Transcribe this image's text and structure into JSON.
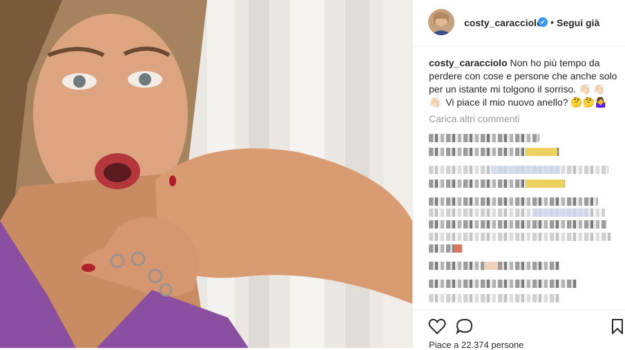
{
  "post": {
    "username": "costy_caracciolo",
    "follow_status": "Segui già",
    "separator": "•",
    "verified_glyph": "✔",
    "caption_user": "costy_caracciolo",
    "caption_text": " Non ho più tempo da perdere con cose e persone che anche solo per un istante mi tolgono il sorriso. ",
    "caption_emoji": "👋🏻👋🏻👋🏻",
    "caption_text2": " Vi piace il mio nuovo anello? ",
    "caption_emoji2": "🤔🤔🤷‍♀️",
    "load_more": "Carica altri commenti",
    "likes": "Piace a 22.374 persone"
  },
  "icons": {
    "like": "heart-icon",
    "comment": "comment-icon",
    "save": "bookmark-icon",
    "verified": "verified-badge-icon"
  },
  "colors": {
    "verified_blue": "#3897f0",
    "text": "#262626",
    "muted": "#999999",
    "dress": "#8a4fa0"
  }
}
